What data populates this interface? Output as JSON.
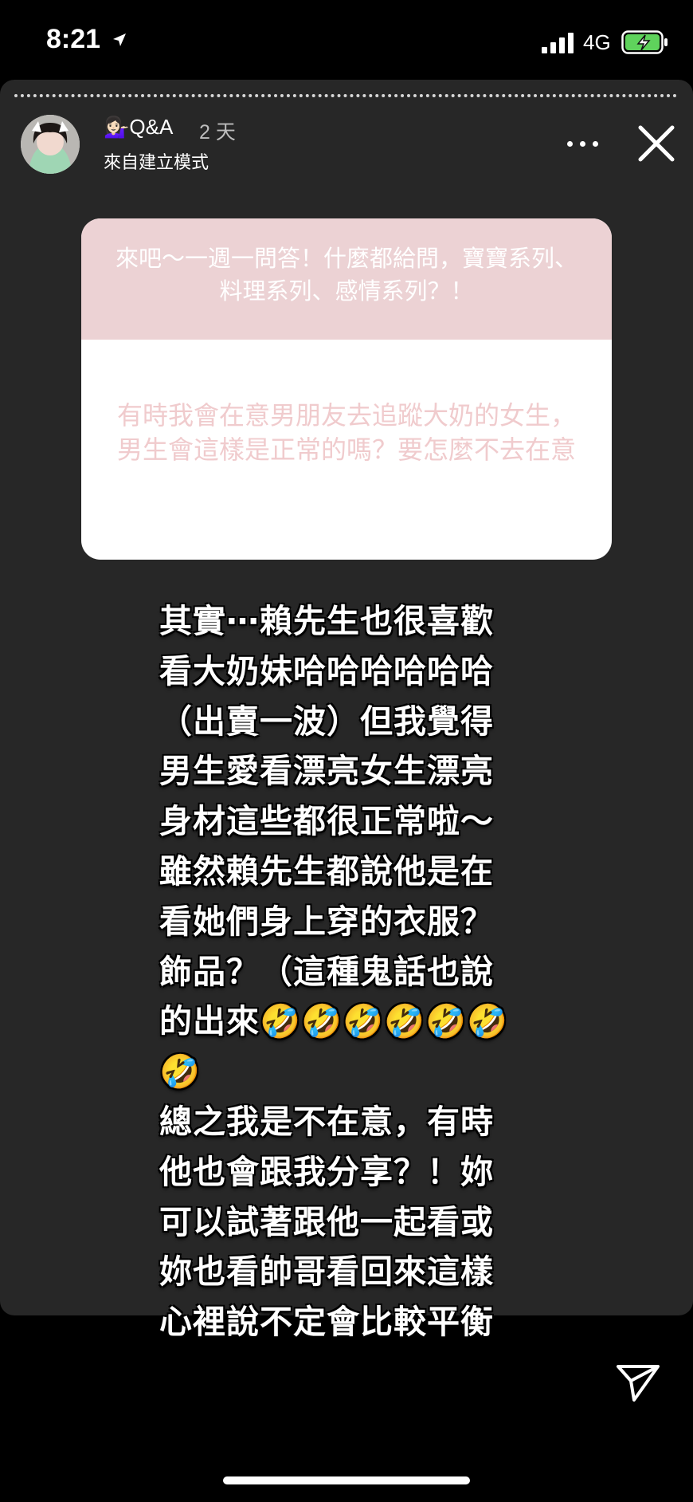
{
  "status_bar": {
    "time": "8:21",
    "network": "4G",
    "icons": [
      "location-arrow-icon",
      "signal-icon",
      "battery-charging-icon"
    ]
  },
  "story": {
    "user_name": "💁🏻‍♀️Q&A",
    "time_ago": "2 天",
    "subtitle": "來自建立模式",
    "icons": [
      "more-icon",
      "close-icon",
      "send-icon"
    ]
  },
  "question_card": {
    "prompt": "來吧～一週一問答！什麼都給問，寶寶系列、料理系列、感情系列？！",
    "answer": "有時我會在意男朋友去追蹤大奶的女生，男生會這樣是正常的嗎？要怎麼不去在意"
  },
  "body_text": "其實⋯賴先生也很喜歡\n看大奶妹哈哈哈哈哈哈\n（出賣一波）但我覺得\n男生愛看漂亮女生漂亮\n身材這些都很正常啦～\n雖然賴先生都說他是在\n看她們身上穿的衣服？\n飾品？（這種鬼話也說\n的出來🤣🤣🤣🤣🤣🤣🤣\n總之我是不在意，有時\n他也會跟我分享？！妳\n可以試著跟他一起看或\n妳也看帥哥看回來這樣\n心裡說不定會比較平衡",
  "colors": {
    "story_bg": "#272727",
    "question_header_bg": "#ecd2d4",
    "answer_text": "#f0cbcd"
  }
}
